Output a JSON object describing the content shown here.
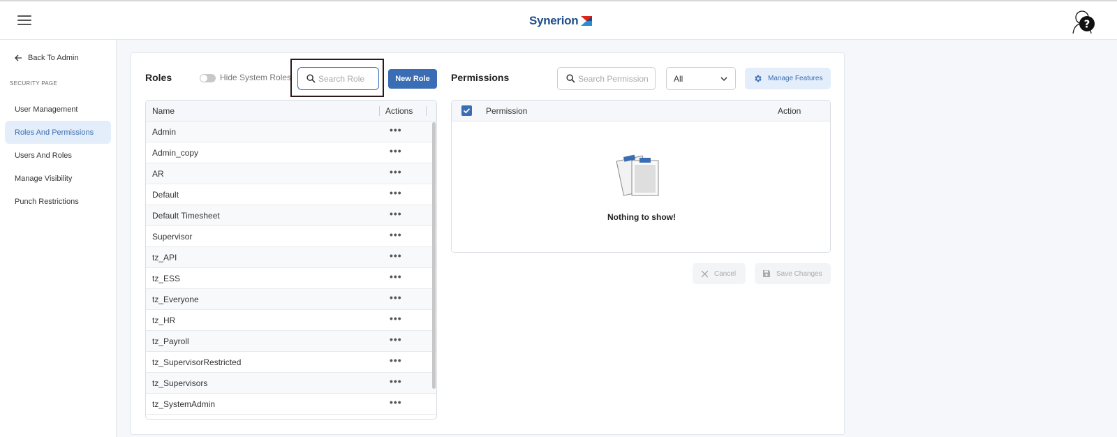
{
  "header": {
    "brand": "Synerion",
    "help_glyph": "?"
  },
  "sidebar": {
    "back_label": "Back To Admin",
    "section_label": "SECURITY PAGE",
    "items": [
      {
        "label": "User Management",
        "active": false
      },
      {
        "label": "Roles And Permissions",
        "active": true
      },
      {
        "label": "Users And Roles",
        "active": false
      },
      {
        "label": "Manage Visibility",
        "active": false
      },
      {
        "label": "Punch Restrictions",
        "active": false
      }
    ]
  },
  "roles": {
    "title": "Roles",
    "hide_system_label": "Hide System Roles",
    "hide_system_on": false,
    "search_placeholder": "Search Role",
    "new_button": "New Role",
    "columns": {
      "name": "Name",
      "actions": "Actions"
    },
    "rows": [
      "Admin",
      "Admin_copy",
      "AR",
      "Default",
      "Default Timesheet",
      "Supervisor",
      "tz_API",
      "tz_ESS",
      "tz_Everyone",
      "tz_HR",
      "tz_Payroll",
      "tz_SupervisorRestricted",
      "tz_Supervisors",
      "tz_SystemAdmin"
    ],
    "row_action_glyph": "•••"
  },
  "permissions": {
    "title": "Permissions",
    "search_placeholder": "Search Permission",
    "filter_value": "All",
    "manage_button": "Manage Features",
    "columns": {
      "permission": "Permission",
      "action": "Action"
    },
    "empty_text": "Nothing to show!",
    "cancel_button": "Cancel",
    "save_button": "Save Changes"
  },
  "colors": {
    "accent": "#3a6db3",
    "accent_light": "#e4eefa",
    "brand_text": "#1d4e89"
  },
  "icons": [
    "menu-icon",
    "help-icon",
    "arrow-left-icon",
    "search-icon",
    "chevron-down-icon",
    "gear-icon",
    "checkbox-icon",
    "clipboard-icon",
    "close-icon",
    "save-icon"
  ]
}
